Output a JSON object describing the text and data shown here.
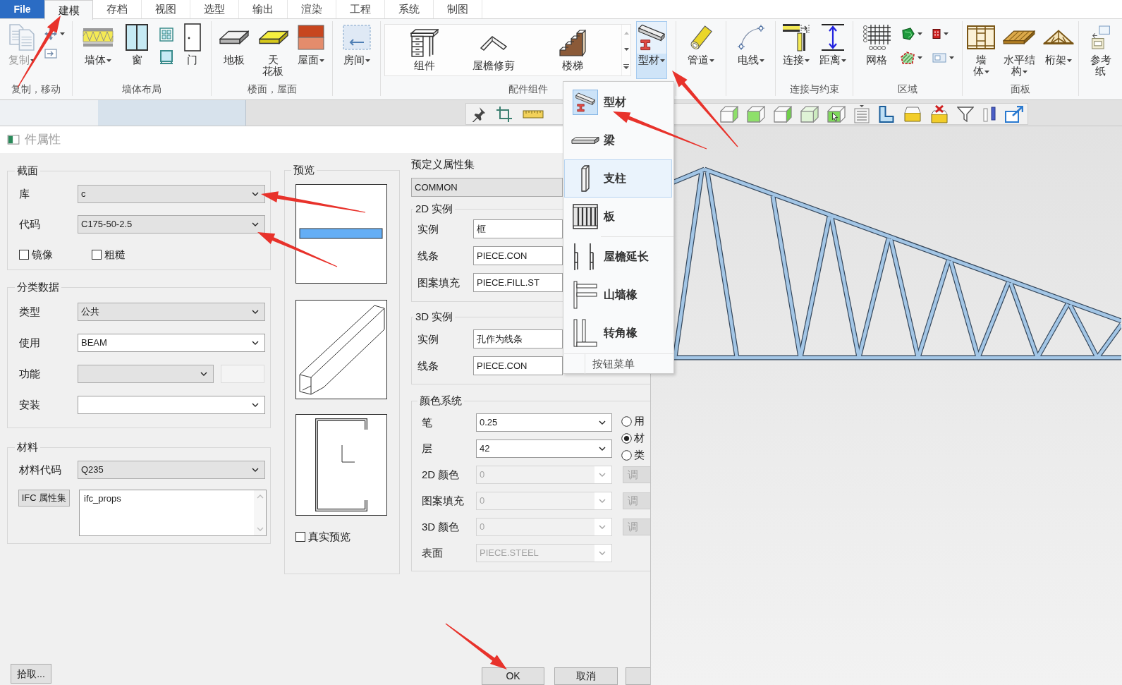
{
  "ribbon": {
    "tabs": [
      {
        "kind": "file",
        "label": "File",
        "selected": false
      },
      {
        "kind": "tab",
        "label": "建模",
        "selected": true
      },
      {
        "kind": "tab",
        "label": "存档",
        "selected": false
      },
      {
        "kind": "tab",
        "label": "视图",
        "selected": false
      },
      {
        "kind": "tab",
        "label": "选型",
        "selected": false
      },
      {
        "kind": "tab",
        "label": "输出",
        "selected": false
      },
      {
        "kind": "tab",
        "label": "渲染",
        "selected": false
      },
      {
        "kind": "tab",
        "label": "工程",
        "selected": false
      },
      {
        "kind": "tab",
        "label": "系统",
        "selected": false
      },
      {
        "kind": "tab",
        "label": "制图",
        "selected": false
      }
    ],
    "groups": [
      {
        "label": "复制，移动",
        "items": [
          {
            "kind": "large",
            "label": "复制",
            "dropdown": true,
            "disabled": true,
            "expanded": false
          },
          {
            "kind": "stack",
            "items": [
              {
                "dropdown": true
              },
              {
                "dropdown": false
              }
            ]
          }
        ]
      },
      {
        "label": "墙体布局",
        "items": [
          {
            "kind": "large",
            "label": "墙体",
            "dropdown": true,
            "disabled": false,
            "expanded": false
          },
          {
            "kind": "large",
            "label": "窗",
            "dropdown": false,
            "disabled": false,
            "expanded": false
          },
          {
            "kind": "stack",
            "items": [
              {
                "dropdown": false
              },
              {
                "dropdown": false
              }
            ]
          },
          {
            "kind": "large",
            "label": "门",
            "dropdown": false,
            "disabled": false,
            "expanded": false
          }
        ]
      },
      {
        "label": "楼面，屋面",
        "items": [
          {
            "kind": "large",
            "label": "地板",
            "dropdown": false,
            "disabled": false,
            "expanded": false
          },
          {
            "kind": "large",
            "label": "天花板",
            "dropdown": false,
            "disabled": false,
            "expanded": false
          },
          {
            "kind": "large",
            "label": "屋面",
            "dropdown": true,
            "disabled": false,
            "expanded": false
          }
        ]
      },
      {
        "items": [
          {
            "kind": "large",
            "label": "房间",
            "dropdown": true,
            "disabled": false,
            "expanded": false
          }
        ]
      },
      {
        "label": "配件组件",
        "items": [
          {
            "kind": "gallery",
            "items": [
              {
                "label": "组件"
              },
              {
                "label": "屋檐修剪"
              },
              {
                "label": "楼梯"
              }
            ]
          },
          {
            "kind": "large",
            "label": "型材",
            "dropdown": true,
            "disabled": false,
            "expanded": true
          }
        ]
      },
      {
        "items": [
          {
            "kind": "large",
            "label": "管道",
            "dropdown": true,
            "disabled": false,
            "expanded": false
          }
        ]
      },
      {
        "items": [
          {
            "kind": "large",
            "label": "电线",
            "dropdown": true,
            "disabled": false,
            "expanded": false
          }
        ]
      },
      {
        "label": "连接与约束",
        "items": [
          {
            "kind": "large",
            "label": "连接",
            "dropdown": true,
            "disabled": false,
            "expanded": false
          },
          {
            "kind": "large",
            "label": "距离",
            "dropdown": true,
            "disabled": false,
            "expanded": false
          }
        ]
      },
      {
        "label": "区域",
        "items": [
          {
            "kind": "large",
            "label": "网格",
            "dropdown": false,
            "disabled": false,
            "expanded": false
          },
          {
            "kind": "grid",
            "items": [
              {
                "dropdown": true
              },
              {
                "dropdown": true
              },
              {
                "dropdown": true
              },
              {
                "dropdown": true
              }
            ]
          }
        ]
      },
      {
        "label": "面板",
        "items": [
          {
            "kind": "large",
            "label": "墙体",
            "dropdown": true,
            "disabled": false,
            "expanded": false
          },
          {
            "kind": "large",
            "label": "水平结构",
            "dropdown": true,
            "disabled": false,
            "expanded": false
          },
          {
            "kind": "large",
            "label": "桁架",
            "dropdown": true,
            "disabled": false,
            "expanded": false
          }
        ]
      },
      {
        "items": [
          {
            "kind": "large",
            "label": "参考纸",
            "dropdown": false,
            "disabled": false,
            "expanded": false
          }
        ]
      }
    ]
  },
  "profile_menu": {
    "items": [
      {
        "kind": "item",
        "label": "型材",
        "selected": true,
        "hovered": false
      },
      {
        "kind": "item",
        "label": "梁",
        "selected": false,
        "hovered": false
      },
      {
        "kind": "item",
        "label": "支柱",
        "selected": false,
        "hovered": true
      },
      {
        "kind": "item",
        "label": "板",
        "selected": false,
        "hovered": false
      },
      {
        "kind": "separator"
      },
      {
        "kind": "item",
        "label": "屋檐延长",
        "selected": false,
        "hovered": false
      },
      {
        "kind": "item",
        "label": "山墙椽",
        "selected": false,
        "hovered": false
      },
      {
        "kind": "item",
        "label": "转角椽",
        "selected": false,
        "hovered": false
      }
    ],
    "footer": "按钮菜单"
  },
  "dialog": {
    "title": "件属性",
    "cross_section": {
      "title": "截面",
      "fields": [
        {
          "label": "库",
          "kind": "list",
          "value": "c",
          "disabled": false
        },
        {
          "label": "代码",
          "kind": "list",
          "value": "C175-50-2.5",
          "disabled": false
        }
      ],
      "checkboxes": [
        {
          "label": "镜像",
          "checked": false
        },
        {
          "label": "粗糙",
          "checked": false
        }
      ]
    },
    "classification": {
      "title": "分类数据",
      "fields": [
        {
          "label": "类型",
          "kind": "list",
          "value": "公共",
          "disabled": false
        },
        {
          "label": "使用",
          "kind": "combo",
          "value": "BEAM",
          "disabled": false
        },
        {
          "label": "功能",
          "kind": "list",
          "disabled": false,
          "side_field": {
            "disabled": true
          }
        },
        {
          "label": "安装",
          "kind": "combo",
          "disabled": false
        }
      ]
    },
    "material": {
      "title": "材料",
      "fields": [
        {
          "label": "材料代码",
          "kind": "list",
          "value": "Q235",
          "disabled": false
        }
      ],
      "ifc_button": "IFC 属性集",
      "ifc_value": "ifc_props"
    },
    "preview": {
      "title": "预览",
      "checkbox": {
        "label": "真实预览",
        "checked": false
      }
    },
    "predefined": {
      "label": "预定义属性集",
      "kind": "list",
      "value": "COMMON"
    },
    "instance_2d": {
      "title": "2D 实例",
      "fields": [
        {
          "label": "实例",
          "kind": "text",
          "value": "框",
          "disabled": false
        },
        {
          "label": "线条",
          "kind": "text",
          "value": "PIECE.CON",
          "disabled": false
        },
        {
          "label": "图案填充",
          "kind": "text",
          "value": "PIECE.FILL.ST",
          "disabled": false
        }
      ]
    },
    "instance_3d": {
      "title": "3D 实例",
      "fields": [
        {
          "label": "实例",
          "kind": "text",
          "value": "孔作为线条",
          "disabled": false
        },
        {
          "label": "线条",
          "kind": "text",
          "value": "PIECE.CON",
          "disabled": false
        }
      ]
    },
    "color_system": {
      "title": "颜色系统",
      "fields": [
        {
          "label": "笔",
          "kind": "combo",
          "value": "0.25",
          "disabled": false
        },
        {
          "label": "层",
          "kind": "combo",
          "value": "42",
          "disabled": false
        },
        {
          "label": "2D 颜色",
          "kind": "combo",
          "value": "0",
          "disabled": true
        },
        {
          "label": "图案填充",
          "kind": "combo",
          "value": "0",
          "disabled": true
        },
        {
          "label": "3D 颜色",
          "kind": "combo",
          "value": "0",
          "disabled": true
        },
        {
          "label": "表面",
          "kind": "combo",
          "value": "PIECE.STEEL",
          "disabled": true
        }
      ],
      "radios": [
        {
          "label": "用",
          "selected": false
        },
        {
          "label": "材",
          "selected": true
        },
        {
          "label": "类",
          "selected": false
        }
      ],
      "palette_buttons": [
        {
          "label": "调",
          "disabled": true
        },
        {
          "label": "调",
          "disabled": true
        },
        {
          "label": "调",
          "disabled": true
        }
      ]
    },
    "left_buttons": [
      {
        "label": "拾取..."
      }
    ],
    "buttons": [
      {
        "kind": "button",
        "label": "OK"
      },
      {
        "kind": "button",
        "label": "取消"
      },
      {
        "kind": "cut"
      }
    ]
  }
}
